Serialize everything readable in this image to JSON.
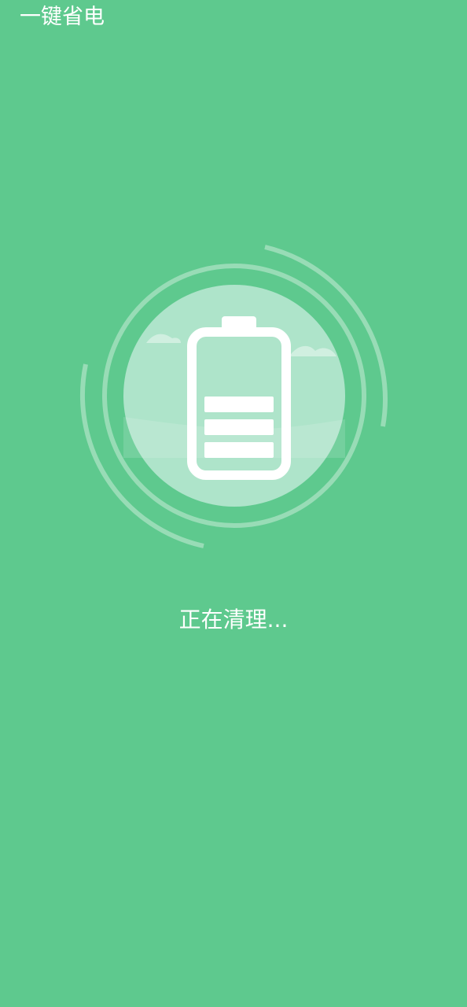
{
  "app": {
    "title": "一键省电"
  },
  "cleanup": {
    "status_text": "正在清理...",
    "battery_bars": 3
  },
  "colors": {
    "background": "#5ec98e",
    "inner_circle": "#aee4ca",
    "battery": "#ffffff"
  },
  "icons": {
    "hero": "battery-icon"
  }
}
